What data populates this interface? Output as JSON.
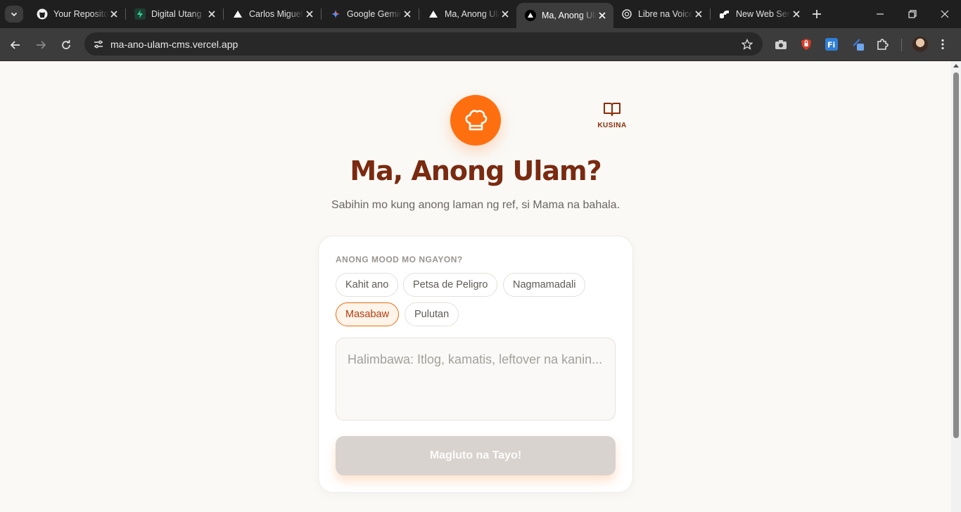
{
  "browser": {
    "tabs": [
      {
        "title": "Your Repositories",
        "favicon": "github-icon"
      },
      {
        "title": "Digital Utang Tracker",
        "favicon": "bolt-icon"
      },
      {
        "title": "Carlos Miguel",
        "favicon": "vercel-icon"
      },
      {
        "title": "Google Gemini",
        "favicon": "gemini-icon"
      },
      {
        "title": "Ma, Anong Ulam?",
        "favicon": "vercel-icon"
      },
      {
        "title": "Ma, Anong Ulam?",
        "favicon": "vercel-icon",
        "active": true
      },
      {
        "title": "Libre na Voice",
        "favicon": "openai-icon"
      },
      {
        "title": "New Web Service",
        "favicon": "render-icon"
      }
    ],
    "url": "ma-ano-ulam-cms.vercel.app"
  },
  "app": {
    "title": "Ma, Anong Ulam?",
    "subtitle": "Sabihin mo kung anong laman ng ref, si Mama na bahala.",
    "nav_label": "KUSINA",
    "mood_label": "ANONG MOOD MO NGAYON?",
    "moods": [
      "Kahit ano",
      "Petsa de Peligro",
      "Nagmamadali",
      "Masabaw",
      "Pulutan"
    ],
    "selected_mood": "Masabaw",
    "ingredients_placeholder": "Halimbawa: Itlog, kamatis, leftover na kanin...",
    "ingredients_value": "",
    "submit_label": "Magluto na Tayo!"
  },
  "colors": {
    "accent": "#ff6f0f",
    "title": "#7a2a10",
    "button_disabled": "#d8d3cf"
  }
}
